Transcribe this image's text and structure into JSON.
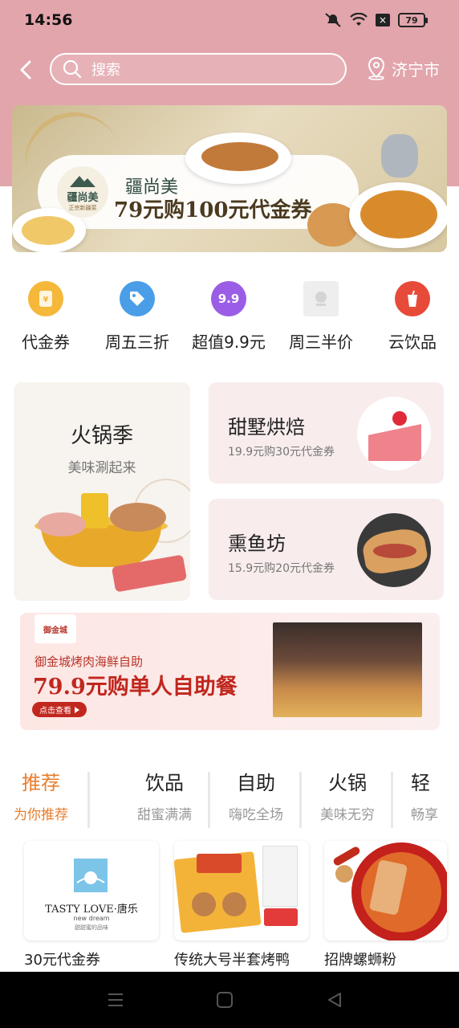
{
  "status_bar": {
    "time": "14:56",
    "battery": "79"
  },
  "header": {
    "search_placeholder": "搜索",
    "city": "济宁市"
  },
  "banner": {
    "brand": "疆尚美",
    "logo_text": "疆尚美",
    "logo_sub": "正宗新疆菜",
    "deal": "79元购100元代金券"
  },
  "categories": [
    {
      "label": "代金券",
      "icon": "coupon-icon",
      "color": "#f5b83a"
    },
    {
      "label": "周五三折",
      "icon": "tag-icon",
      "color": "#4a9ee8"
    },
    {
      "label": "超值9.9元",
      "icon": "price-99-icon",
      "color": "#9b5de5",
      "badge": "9.9"
    },
    {
      "label": "周三半价",
      "icon": "half-price-icon",
      "color": "#eeeeee"
    },
    {
      "label": "云饮品",
      "icon": "drink-icon",
      "color": "#e84a3a"
    }
  ],
  "features": {
    "hotpot": {
      "title": "火锅季",
      "subtitle": "美味涮起来"
    },
    "bakery": {
      "title": "甜墅烘焙",
      "subtitle": "19.9元购30元代金券"
    },
    "fish": {
      "title": "熏鱼坊",
      "subtitle": "15.9元购20元代金券"
    }
  },
  "buffet": {
    "logo": "御金城",
    "name": "御金城烤肉海鲜自助",
    "deal": "79.9元购单人自助餐",
    "button": "点击查看"
  },
  "tabs": [
    {
      "title": "推荐",
      "subtitle": "为你推荐",
      "active": true
    },
    {
      "title": "饮品",
      "subtitle": "甜蜜满满"
    },
    {
      "title": "自助",
      "subtitle": "嗨吃全场"
    },
    {
      "title": "火锅",
      "subtitle": "美味无穷"
    },
    {
      "title": "轻",
      "subtitle": "畅享"
    }
  ],
  "products": [
    {
      "name": "30元代金券",
      "logo_text": "TASTY LOVE·唐乐",
      "logo_sub": "new dream",
      "logo_cn": "甜甜蜜的品味"
    },
    {
      "name": "传统大号半套烤鸭"
    },
    {
      "name": "招牌螺蛳粉"
    }
  ],
  "colors": {
    "header_bg": "#e2a5ac",
    "accent": "#e87e2c",
    "buffet_red": "#c1271e"
  }
}
